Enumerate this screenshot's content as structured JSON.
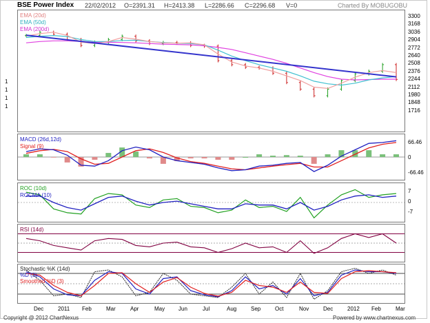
{
  "header": {
    "title": "BSE Power Index",
    "date": "22/02/2012",
    "open": "O=2391.31",
    "high": "H=2413.38",
    "low": "L=2286.66",
    "close": "C=2296.68",
    "volume": "V=0",
    "charted_by": "Charted By MOBUGOBU"
  },
  "footer": {
    "copyright": "Copyright @ 2012 ChartNexus",
    "powered_by": "Powered by www.chartnexus.com"
  },
  "colors": {
    "up": "#1e9e1e",
    "down": "#cc2222",
    "ema20": "#f0a0a0",
    "ema50": "#40c0d0",
    "ema200": "#e040e0",
    "trendline": "#3333cc",
    "macd": "#2020c0",
    "signal": "#e02020",
    "roc": "#20a020",
    "rocma": "#2020c0",
    "rsi": "#800040",
    "stoch_k": "#222222",
    "stoch_d": "#2020c0",
    "stoch_sd": "#e02020"
  },
  "chart_data": [
    {
      "type": "line",
      "panel": "price",
      "title": "BSE Power Index",
      "series": [
        {
          "name": "EMA (20d)",
          "values": [
            2952,
            2990,
            3010,
            2960,
            2860,
            2840,
            2870,
            2930,
            2905,
            2870,
            2850,
            2845,
            2850,
            2820,
            2680,
            2560,
            2500,
            2470,
            2420,
            2350,
            2280,
            2180,
            2160,
            2240,
            2330,
            2400,
            2430,
            2400
          ]
        },
        {
          "name": "EMA (50d)",
          "values": [
            2930,
            2950,
            2960,
            2945,
            2900,
            2870,
            2870,
            2885,
            2890,
            2870,
            2855,
            2845,
            2840,
            2820,
            2740,
            2650,
            2580,
            2520,
            2470,
            2420,
            2350,
            2270,
            2230,
            2210,
            2240,
            2290,
            2320,
            2340
          ]
        },
        {
          "name": "EMA (200d)",
          "values": [
            2850,
            2870,
            2880,
            2880,
            2870,
            2860,
            2858,
            2855,
            2850,
            2840,
            2830,
            2825,
            2820,
            2805,
            2780,
            2750,
            2700,
            2650,
            2600,
            2540,
            2470,
            2400,
            2340,
            2300,
            2290,
            2295,
            2300,
            2300
          ]
        },
        {
          "name": "Close",
          "values": [
            2960,
            3010,
            2980,
            2900,
            2810,
            2860,
            2900,
            2950,
            2880,
            2840,
            2855,
            2850,
            2810,
            2800,
            2580,
            2520,
            2480,
            2470,
            2390,
            2250,
            2150,
            2050,
            2150,
            2280,
            2380,
            2420,
            2520,
            2297
          ]
        }
      ],
      "x": [
        0,
        1,
        2,
        3,
        4,
        5,
        6,
        7,
        8,
        9,
        10,
        11,
        12,
        13,
        14,
        15,
        16,
        17,
        18,
        19,
        20,
        21,
        22,
        23,
        24,
        25,
        26,
        27
      ],
      "ylim": [
        1550,
        3300
      ],
      "y_ticks": [
        "3300",
        "3168",
        "3036",
        "2904",
        "2772",
        "2640",
        "2508",
        "2376",
        "2244",
        "2112",
        "1980",
        "1848",
        "1716"
      ],
      "left_ticks": [
        "1",
        "1",
        "1",
        "1"
      ],
      "trendline": {
        "from": [
          0,
          2965
        ],
        "to": [
          27,
          2335
        ]
      }
    },
    {
      "type": "bar",
      "panel": "macd",
      "series": [
        {
          "name": "MACD (26d,12d)",
          "values": [
            30,
            45,
            40,
            10,
            -45,
            -50,
            -20,
            35,
            55,
            40,
            0,
            -20,
            -30,
            -40,
            -60,
            -75,
            -70,
            -50,
            -45,
            -35,
            -30,
            -80,
            -45,
            5,
            40,
            75,
            80,
            90
          ]
        },
        {
          "name": "Signal (9)",
          "values": [
            20,
            35,
            42,
            30,
            -10,
            -40,
            -35,
            0,
            35,
            45,
            25,
            -5,
            -25,
            -35,
            -50,
            -65,
            -70,
            -60,
            -50,
            -42,
            -35,
            -55,
            -55,
            -20,
            15,
            50,
            70,
            80
          ]
        }
      ],
      "y_ticks": [
        "66.46",
        "0",
        "-66.46"
      ],
      "ylim": [
        -110,
        110
      ]
    },
    {
      "type": "line",
      "panel": "roc",
      "series": [
        {
          "name": "ROC (10d)",
          "values": [
            8,
            6,
            -5,
            -8,
            -9,
            3,
            7,
            6,
            -2,
            -4,
            2,
            3,
            -3,
            -4,
            -8,
            -6,
            2,
            -4,
            -3,
            -7,
            4,
            -12,
            -2,
            6,
            10,
            4,
            6,
            7
          ]
        },
        {
          "name": "ROCMA (10)",
          "values": [
            5,
            5,
            0,
            -4,
            -6,
            -1,
            4,
            5,
            1,
            -2,
            0,
            1,
            -1,
            -3,
            -5,
            -5,
            -1,
            -2,
            -2,
            -5,
            0,
            -6,
            -3,
            2,
            5,
            6,
            4,
            5
          ]
        }
      ],
      "y_ticks": [
        "7",
        "0",
        "-7"
      ],
      "ylim": [
        -14,
        14
      ]
    },
    {
      "type": "line",
      "panel": "rsi",
      "series": [
        {
          "name": "RSI (14d)",
          "values": [
            60,
            55,
            45,
            40,
            35,
            55,
            60,
            58,
            45,
            42,
            50,
            52,
            42,
            40,
            30,
            38,
            50,
            40,
            42,
            30,
            55,
            28,
            40,
            60,
            70,
            62,
            70,
            50
          ]
        }
      ],
      "levels": [
        30,
        50,
        70
      ],
      "ylim": [
        10,
        90
      ]
    },
    {
      "type": "line",
      "panel": "stochastic",
      "series": [
        {
          "name": "Stochastic %K (14d)",
          "values": [
            90,
            60,
            15,
            20,
            10,
            85,
            90,
            70,
            15,
            25,
            80,
            60,
            20,
            15,
            10,
            40,
            80,
            20,
            55,
            10,
            80,
            5,
            30,
            85,
            95,
            80,
            90,
            75
          ]
        },
        {
          "name": "%D (3)",
          "values": [
            85,
            70,
            35,
            18,
            15,
            60,
            85,
            80,
            35,
            20,
            65,
            70,
            30,
            18,
            12,
            30,
            70,
            35,
            45,
            20,
            65,
            15,
            25,
            75,
            90,
            85,
            85,
            80
          ]
        },
        {
          "name": "Smoothed %D (3)",
          "values": [
            80,
            75,
            45,
            25,
            15,
            45,
            80,
            82,
            50,
            25,
            55,
            68,
            40,
            22,
            14,
            25,
            60,
            45,
            40,
            25,
            55,
            25,
            22,
            65,
            85,
            88,
            85,
            82
          ]
        }
      ],
      "levels": [
        20,
        50,
        80
      ],
      "ylim": [
        0,
        100
      ]
    }
  ],
  "x_axis": {
    "labels": [
      "Dec",
      "2011",
      "Feb",
      "Mar",
      "Apr",
      "May",
      "Jun",
      "Jul",
      "Aug",
      "Sep",
      "Oct",
      "Nov",
      "Dec",
      "2012",
      "Feb",
      "Mar"
    ]
  }
}
